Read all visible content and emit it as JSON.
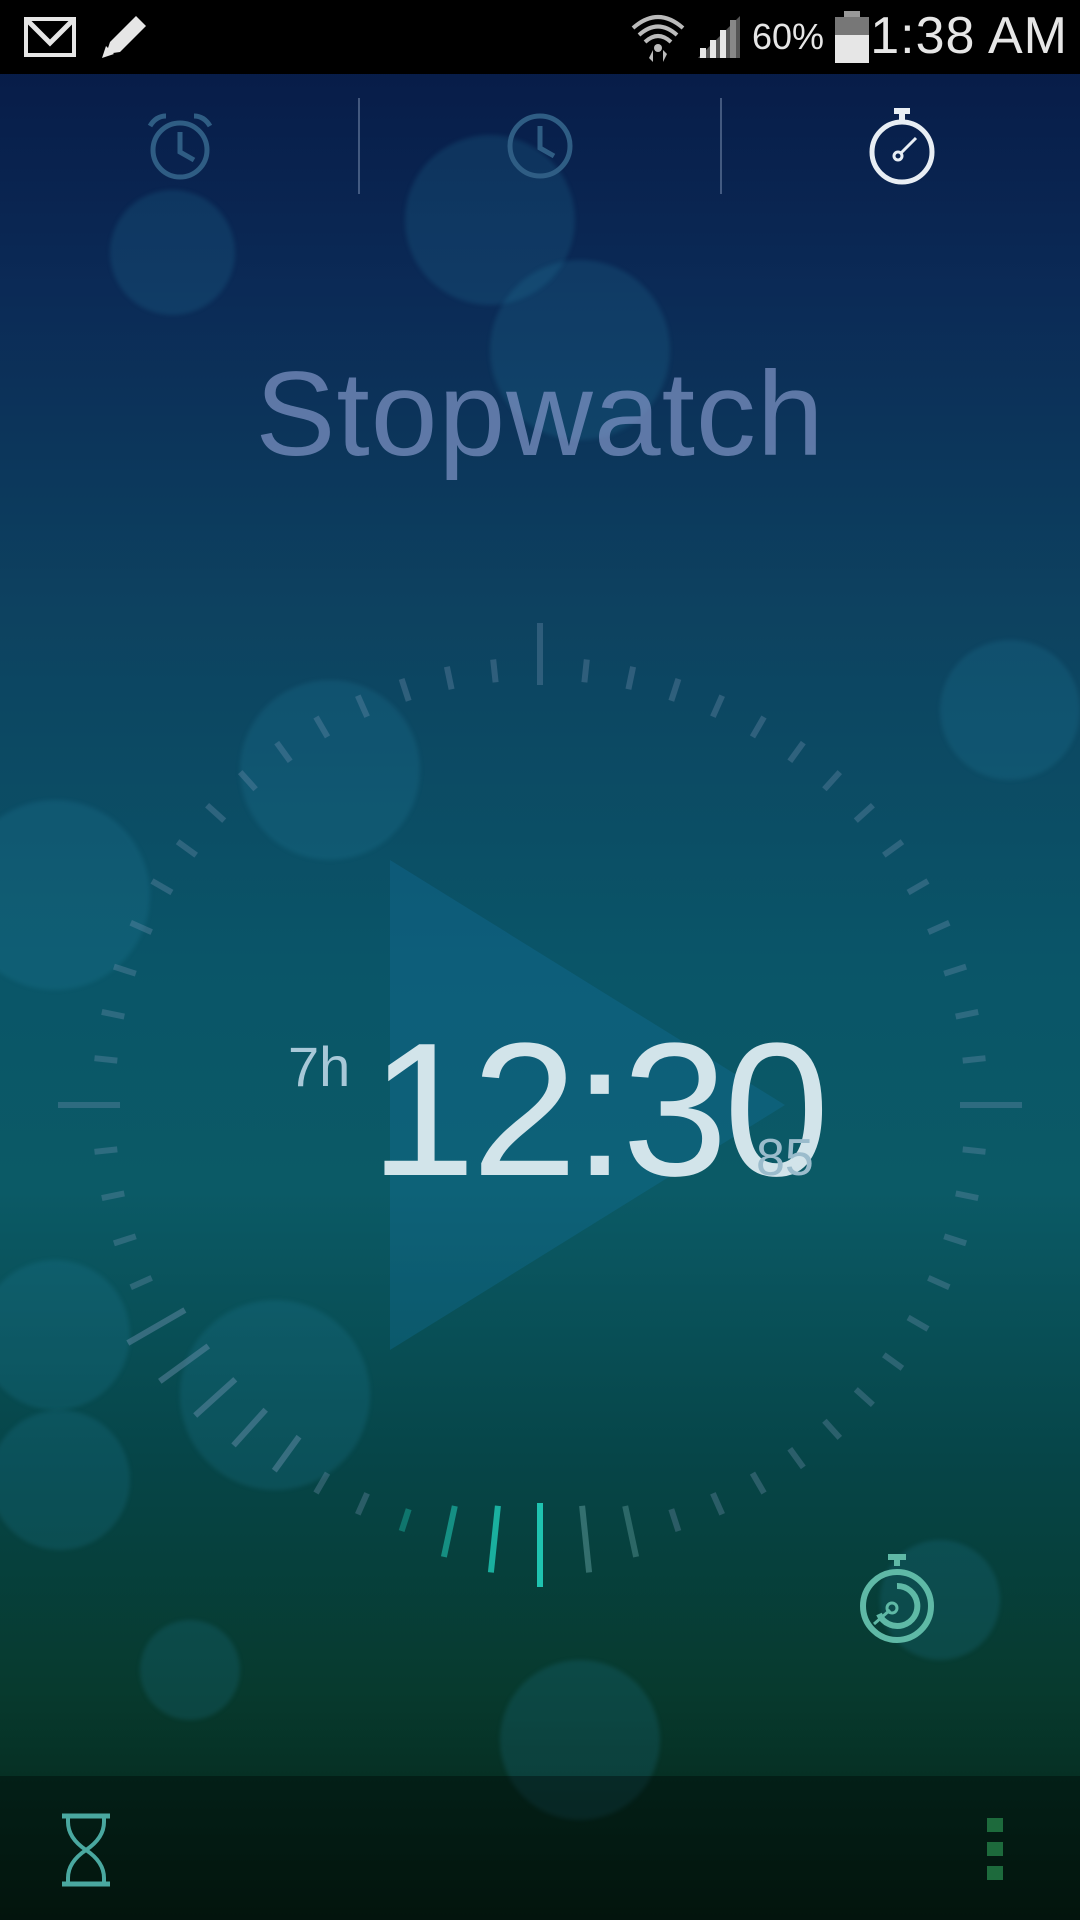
{
  "status_bar": {
    "time": "1:38 AM",
    "battery_percent": "60%",
    "icons": [
      "gmail-icon",
      "pencil-icon",
      "wifi-icon",
      "signal-icon",
      "battery-icon"
    ]
  },
  "tabs": [
    {
      "name": "alarm",
      "icon": "alarm-clock-icon",
      "active": false
    },
    {
      "name": "world-clock",
      "icon": "clock-icon",
      "active": false
    },
    {
      "name": "stopwatch",
      "icon": "stopwatch-icon",
      "active": true
    }
  ],
  "page_title": "Stopwatch",
  "stopwatch": {
    "hours": "7h",
    "time": "12:30",
    "hundredths": "85",
    "progress_fraction": 0.5
  },
  "colors": {
    "accent": "#1fc3b0",
    "lap_icon": "#5fb9a6"
  },
  "bottom_bar": {
    "left_icon": "hourglass-icon",
    "right_icon": "overflow-menu-icon"
  }
}
